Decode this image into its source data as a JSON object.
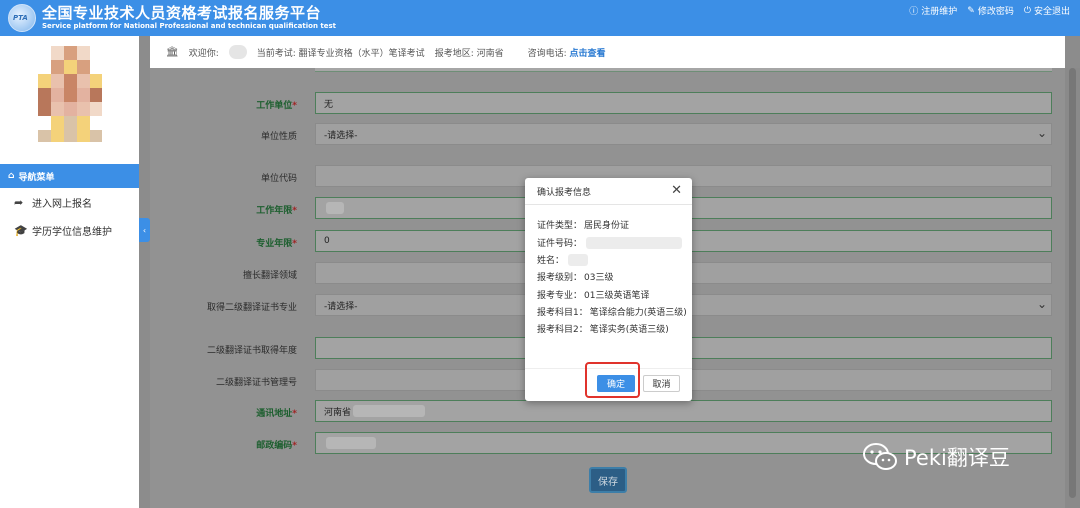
{
  "header": {
    "logo_text": "PTA",
    "title_cn": "全国专业技术人员资格考试报名服务平台",
    "title_en": "Service platform for National Professional and technican qualification test",
    "links": [
      {
        "icon": "info-icon",
        "glyph": "ⓘ",
        "label": "注册维护"
      },
      {
        "icon": "edit-icon",
        "glyph": "✎",
        "label": "修改密码"
      },
      {
        "icon": "power-icon",
        "glyph": "⏻",
        "label": "安全退出"
      }
    ]
  },
  "sidebar": {
    "nav_head": "导航菜单",
    "items": [
      {
        "icon": "share-arrow-icon",
        "glyph": "➦",
        "label": "进入网上报名"
      },
      {
        "icon": "graduation-cap-icon",
        "glyph": "🎓",
        "label": "学历学位信息维护"
      }
    ]
  },
  "infobar": {
    "welcome": "欢迎你:",
    "current_exam_label": "当前考试:",
    "current_exam": "翻译专业资格（水平）笔译考试",
    "region_label": "报考地区:",
    "region": "河南省",
    "phone_label": "咨询电话:",
    "phone_link": "点击查看"
  },
  "form": {
    "rows": [
      {
        "label": "工作单位",
        "required": true,
        "value": "无",
        "kind": "text"
      },
      {
        "label": "单位性质",
        "required": false,
        "value": "-请选择-",
        "kind": "select"
      },
      {
        "label": "单位代码",
        "required": false,
        "value": "",
        "kind": "text"
      },
      {
        "label": "工作年限",
        "required": true,
        "value": "",
        "kind": "blur"
      },
      {
        "label": "专业年限",
        "required": true,
        "value": "0",
        "kind": "text"
      },
      {
        "label": "擅长翻译领域",
        "required": false,
        "value": "",
        "kind": "text"
      },
      {
        "label": "取得二级翻译证书专业",
        "required": false,
        "value": "-请选择-",
        "kind": "select"
      },
      {
        "label": "二级翻译证书取得年度",
        "required": false,
        "value": "",
        "kind": "text"
      },
      {
        "label": "二级翻译证书管理号",
        "required": false,
        "value": "",
        "kind": "text"
      },
      {
        "label": "通讯地址",
        "required": true,
        "value": "河南省",
        "kind": "text"
      },
      {
        "label": "邮政编码",
        "required": true,
        "value": "",
        "kind": "blur"
      }
    ],
    "save_label": "保存"
  },
  "modal": {
    "title": "确认报考信息",
    "close_glyph": "✕",
    "lines": [
      {
        "label": "证件类型：",
        "value": "居民身份证"
      },
      {
        "label": "证件号码：",
        "value": ""
      },
      {
        "label": "姓名：",
        "value": ""
      },
      {
        "label": "报考级别：",
        "value": "03三级"
      },
      {
        "label": "报考专业：",
        "value": "01三级英语笔译"
      },
      {
        "label": "报考科目1：",
        "value": "笔译综合能力(英语三级)"
      },
      {
        "label": "报考科目2：",
        "value": "笔译实务(英语三级)"
      }
    ],
    "ok_label": "确定",
    "cancel_label": "取消",
    "highlight_color": "#e0332c"
  },
  "watermark": {
    "text": "Peki翻译豆"
  },
  "colors": {
    "primary": "#3c8fe6",
    "required_label": "#1d5f2f",
    "link": "#2a7ad2"
  }
}
